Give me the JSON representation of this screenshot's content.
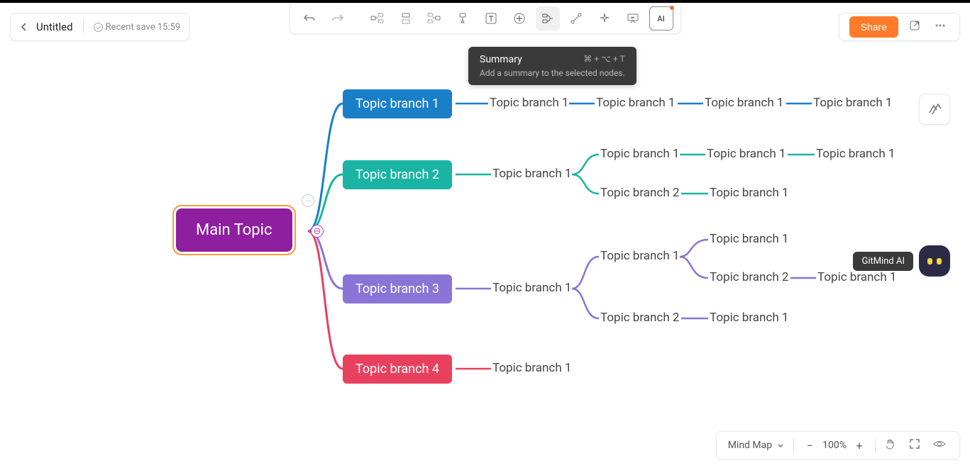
{
  "header": {
    "title": "Untitled",
    "save_status": "Recent save 15:59"
  },
  "tooltip": {
    "title": "Summary",
    "shortcut": "⌘ + ⌥ + T",
    "desc": "Add a summary to the selected nodes."
  },
  "share_label": "Share",
  "ai_label": "GitMind AI",
  "footer": {
    "layout": "Mind Map",
    "zoom": "100%"
  },
  "nodes": {
    "main": "Main Topic",
    "b1": "Topic branch 1",
    "b2": "Topic branch 2",
    "b3": "Topic branch 3",
    "b4": "Topic branch 4",
    "b1c1": "Topic branch 1",
    "b1c2": "Topic branch 1",
    "b1c3": "Topic branch 1",
    "b1c4": "Topic branch 1",
    "b2c1": "Topic branch 1",
    "b2c1a": "Topic branch 1",
    "b2c1a1": "Topic branch 1",
    "b2c1a2": "Topic branch 1",
    "b2c1b": "Topic branch 2",
    "b2c1b1": "Topic branch 1",
    "b3c1": "Topic branch 1",
    "b3c1a": "Topic branch 1",
    "b3c1a1": "Topic branch 1",
    "b3c1a2": "Topic branch 2",
    "b3c1a2x": "Topic branch 1",
    "b3c1b": "Topic branch 2",
    "b3c1b1": "Topic branch 1",
    "b4c1": "Topic branch 1"
  },
  "collapse_symbol": "⊖",
  "menu_symbol": "⋯",
  "colors": {
    "b1": "#1a7fc9",
    "b2": "#1bb4a4",
    "b3": "#8a74d6",
    "b4": "#e8415f",
    "main": "#8e1f9e"
  }
}
